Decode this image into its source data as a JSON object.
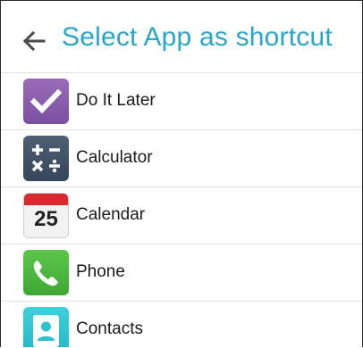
{
  "header": {
    "title": "Select App as shortcut",
    "back_icon": "arrow-left-icon"
  },
  "apps": [
    {
      "label": "Do It Later",
      "icon": "checkmark-icon",
      "color": "#8a5cae"
    },
    {
      "label": "Calculator",
      "icon": "calculator-icon",
      "color": "#3f4f63"
    },
    {
      "label": "Calendar",
      "icon": "calendar-icon",
      "day": "25",
      "color": "#d9292e"
    },
    {
      "label": "Phone",
      "icon": "phone-icon",
      "color": "#4cb83f"
    },
    {
      "label": "Contacts",
      "icon": "contact-icon",
      "color": "#2cc2d0"
    }
  ],
  "colors": {
    "accent": "#2aa6c8",
    "divider": "#e0e0e0"
  }
}
